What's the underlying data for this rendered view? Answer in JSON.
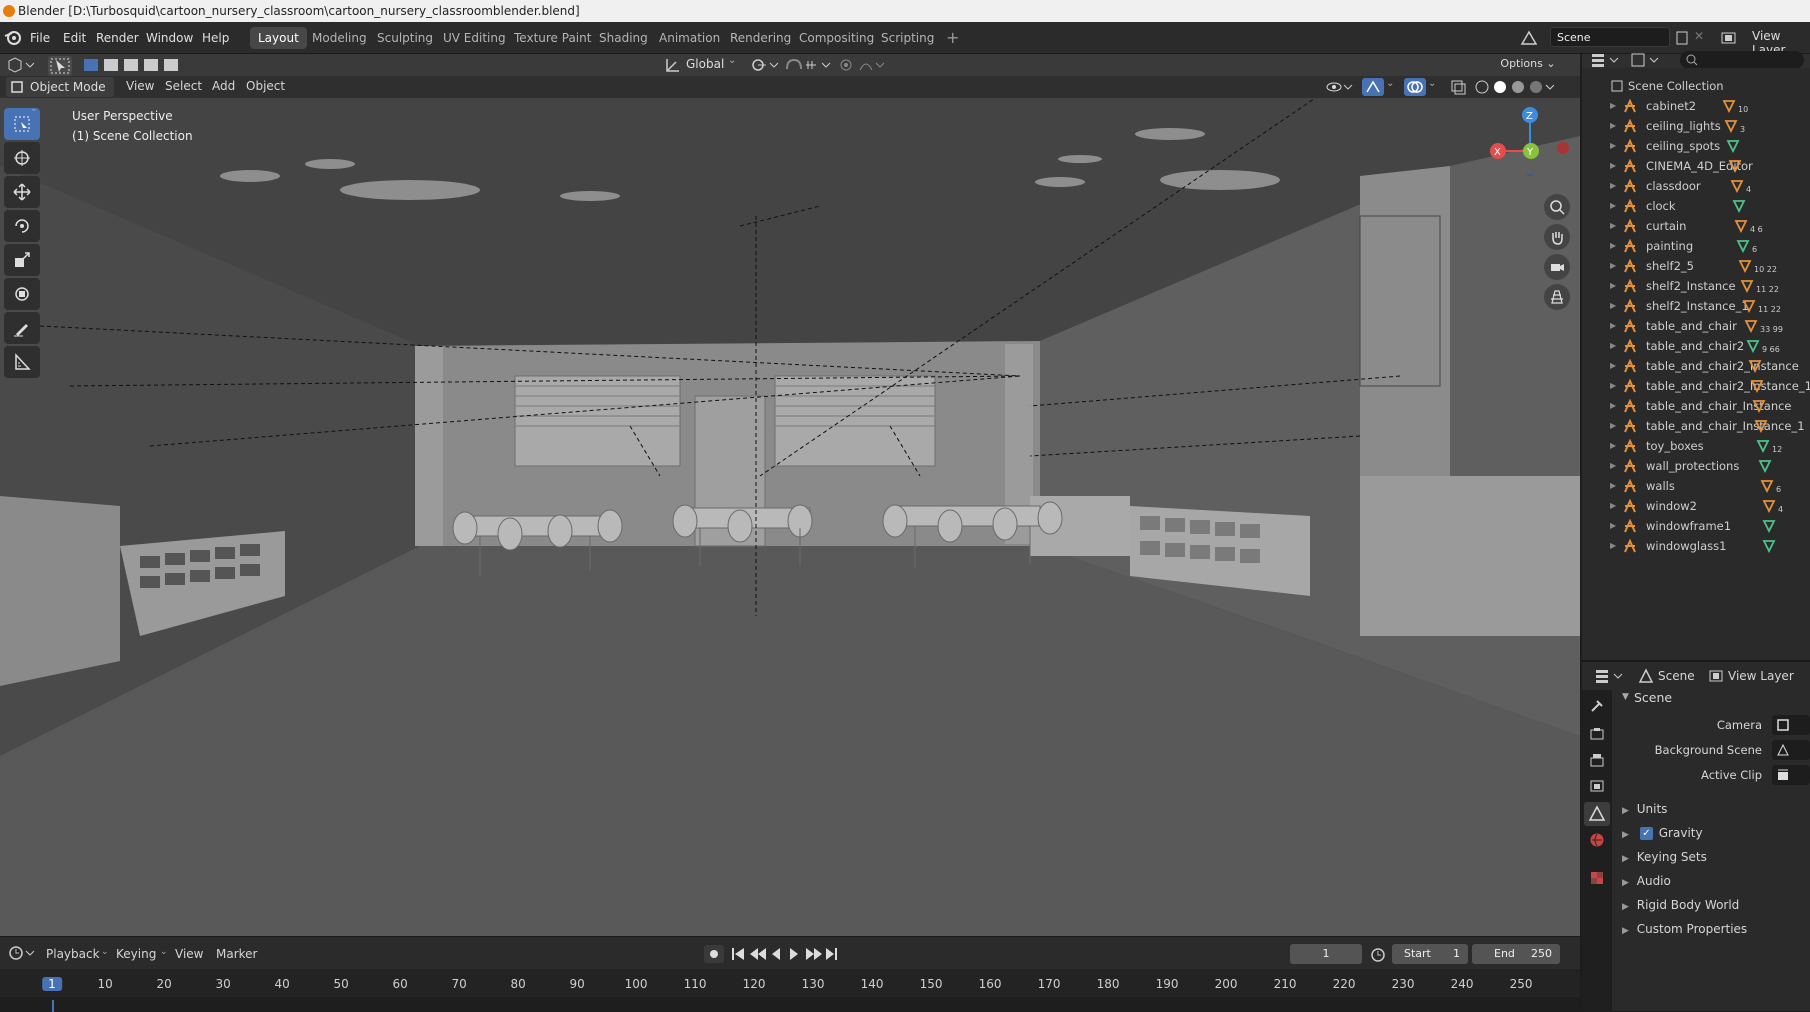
{
  "window": {
    "title": "Blender [D:\\Turbosquid\\cartoon_nursery_classroom\\cartoon_nursery_classroomblender.blend]"
  },
  "menubar": {
    "items": [
      "File",
      "Edit",
      "Render",
      "Window",
      "Help"
    ]
  },
  "workspaces": [
    "Layout",
    "Modeling",
    "Sculpting",
    "UV Editing",
    "Texture Paint",
    "Shading",
    "Animation",
    "Rendering",
    "Compositing",
    "Scripting"
  ],
  "active_workspace": "Layout",
  "scene_selector": {
    "scene": "Scene",
    "view_layer": "View Layer"
  },
  "viewport_header": {
    "mode": "Object Mode",
    "menus": [
      "View",
      "Select",
      "Add",
      "Object"
    ],
    "transform_orientation": "Global",
    "options": "Options"
  },
  "viewport": {
    "overlay_line1": "User Perspective",
    "overlay_line2": "(1) Scene Collection",
    "gizmo_axes": {
      "x": "X",
      "y": "Y",
      "z": "Z"
    }
  },
  "outliner": {
    "root": "Scene Collection",
    "items": [
      {
        "name": "cabinet2",
        "badge": "10"
      },
      {
        "name": "ceiling_lights",
        "badge": "3"
      },
      {
        "name": "ceiling_spots",
        "badge": ""
      },
      {
        "name": "CINEMA_4D_Editor",
        "badge": ""
      },
      {
        "name": "classdoor",
        "badge": "4"
      },
      {
        "name": "clock",
        "badge": ""
      },
      {
        "name": "curtain",
        "badge": "4 6"
      },
      {
        "name": "painting",
        "badge": "6"
      },
      {
        "name": "shelf2_5",
        "badge": "10 22"
      },
      {
        "name": "shelf2_Instance",
        "badge": "11 22"
      },
      {
        "name": "shelf2_Instance_1",
        "badge": "11 22"
      },
      {
        "name": "table_and_chair",
        "badge": "33 99"
      },
      {
        "name": "table_and_chair2",
        "badge": "9 66"
      },
      {
        "name": "table_and_chair2_Instance",
        "badge": ""
      },
      {
        "name": "table_and_chair2_Instance_1",
        "badge": ""
      },
      {
        "name": "table_and_chair_Instance",
        "badge": ""
      },
      {
        "name": "table_and_chair_Instance_1",
        "badge": ""
      },
      {
        "name": "toy_boxes",
        "badge": "12"
      },
      {
        "name": "wall_protections",
        "badge": ""
      },
      {
        "name": "walls",
        "badge": "6"
      },
      {
        "name": "window2",
        "badge": "4"
      },
      {
        "name": "windowframe1",
        "badge": ""
      },
      {
        "name": "windowglass1",
        "badge": ""
      }
    ]
  },
  "properties": {
    "header_scene": "Scene",
    "header_view_layer": "View Layer",
    "panel_title": "Scene",
    "camera_label": "Camera",
    "background_scene_label": "Background Scene",
    "active_clip_label": "Active Clip",
    "subpanels": [
      "Units",
      "Gravity",
      "Keying Sets",
      "Audio",
      "Rigid Body World",
      "Custom Properties"
    ],
    "gravity_checked": true
  },
  "timeline": {
    "menus": [
      "Playback",
      "Keying",
      "View",
      "Marker"
    ],
    "current_frame": "1",
    "start_label": "Start",
    "start_value": "1",
    "end_label": "End",
    "end_value": "250",
    "ruler": [
      "1",
      "10",
      "20",
      "30",
      "40",
      "50",
      "60",
      "70",
      "80",
      "90",
      "100",
      "110",
      "120",
      "130",
      "140",
      "150",
      "160",
      "170",
      "180",
      "190",
      "200",
      "210",
      "220",
      "230",
      "240",
      "250"
    ]
  },
  "colors": {
    "accent": "#4772b3",
    "orange": "#e87d0d",
    "x_axis": "#e44d4d",
    "y_axis": "#8ac33b",
    "z_axis": "#3c8de0"
  }
}
